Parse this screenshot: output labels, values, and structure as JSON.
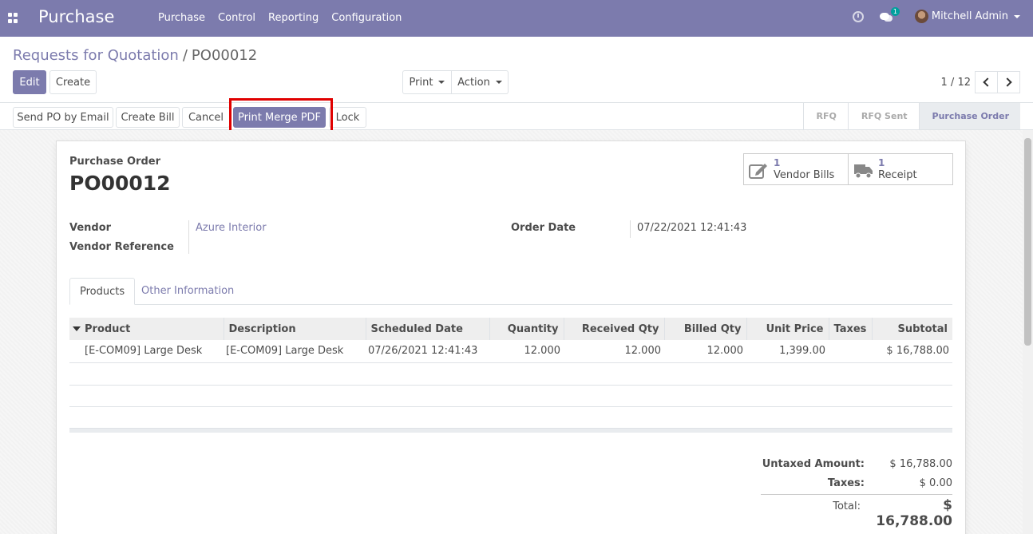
{
  "navbar": {
    "app_name": "Purchase",
    "menu": [
      "Purchase",
      "Control",
      "Reporting",
      "Configuration"
    ],
    "chat_count": "1",
    "user_name": "Mitchell Admin"
  },
  "breadcrumb": {
    "parent": "Requests for Quotation",
    "separator": "/",
    "current": "PO00012"
  },
  "control": {
    "edit_label": "Edit",
    "create_label": "Create",
    "print_label": "Print",
    "action_label": "Action",
    "pager_text": "1 / 12"
  },
  "statusbar": {
    "buttons": [
      "Send PO by Email",
      "Create Bill",
      "Cancel",
      "Print Merge PDF",
      "Lock"
    ],
    "stages": [
      "RFQ",
      "RFQ Sent",
      "Purchase Order"
    ],
    "active_stage": "Purchase Order"
  },
  "form": {
    "doc_type": "Purchase Order",
    "doc_name": "PO00012",
    "smart_buttons": [
      {
        "count": "1",
        "label": "Vendor Bills",
        "icon": "pencil-square-icon"
      },
      {
        "count": "1",
        "label": "Receipt",
        "icon": "truck-icon"
      }
    ],
    "vendor_label": "Vendor",
    "vendor_value": "Azure Interior",
    "vendor_ref_label": "Vendor Reference",
    "vendor_ref_value": "",
    "order_date_label": "Order Date",
    "order_date_value": "07/22/2021 12:41:43"
  },
  "tabs": [
    "Products",
    "Other Information"
  ],
  "lines": {
    "columns": [
      "Product",
      "Description",
      "Scheduled Date",
      "Quantity",
      "Received Qty",
      "Billed Qty",
      "Unit Price",
      "Taxes",
      "Subtotal"
    ],
    "rows": [
      {
        "product": "[E-COM09] Large Desk",
        "description": "[E-COM09] Large Desk",
        "scheduled_date": "07/26/2021 12:41:43",
        "quantity": "12.000",
        "received_qty": "12.000",
        "billed_qty": "12.000",
        "unit_price": "1,399.00",
        "taxes": "",
        "subtotal": "$ 16,788.00"
      }
    ]
  },
  "totals": {
    "untaxed_label": "Untaxed Amount:",
    "untaxed_value": "$ 16,788.00",
    "taxes_label": "Taxes:",
    "taxes_value": "$ 0.00",
    "total_label": "Total:",
    "total_value": "$ 16,788.00"
  },
  "colors": {
    "brand": "#7c7bad",
    "highlight": "#e00000"
  }
}
